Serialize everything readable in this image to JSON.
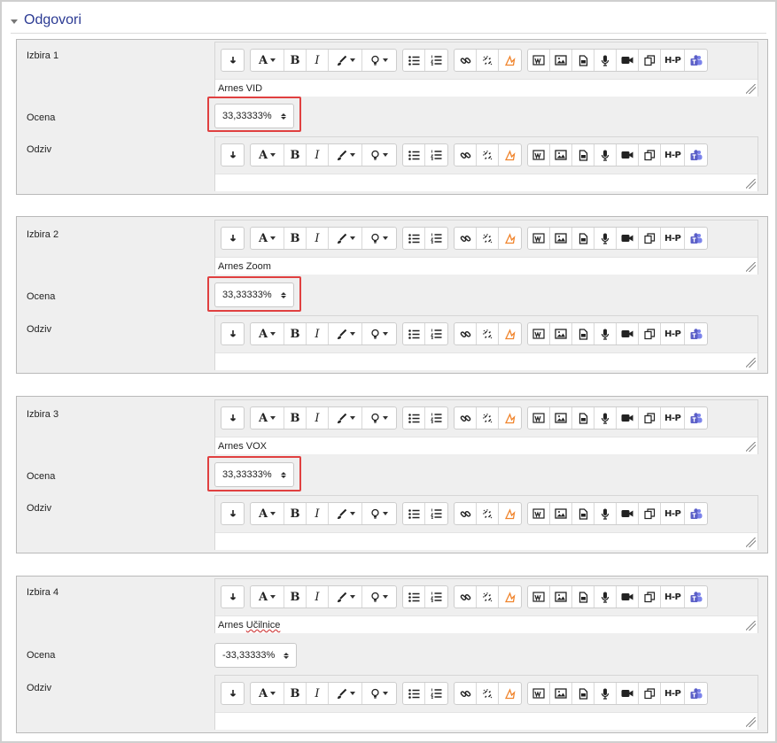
{
  "section": {
    "title": "Odgovori"
  },
  "labels": {
    "grade": "Ocena",
    "feedback": "Odziv"
  },
  "toolbar": [
    {
      "icon": "pilcrow-toggle-icon"
    },
    {
      "icon": "font-color-icon"
    },
    {
      "icon": "bold-icon",
      "text": "B"
    },
    {
      "icon": "italic-icon",
      "text": "I"
    },
    {
      "icon": "brush-icon"
    },
    {
      "icon": "lightbulb-icon"
    },
    {
      "icon": "unordered-list-icon"
    },
    {
      "icon": "ordered-list-icon"
    },
    {
      "icon": "link-icon"
    },
    {
      "icon": "unlink-icon"
    },
    {
      "icon": "emoji-icon"
    },
    {
      "icon": "media-manage-icon"
    },
    {
      "icon": "image-icon"
    },
    {
      "icon": "file-icon"
    },
    {
      "icon": "microphone-icon"
    },
    {
      "icon": "video-icon"
    },
    {
      "icon": "copy-icon"
    },
    {
      "icon": "h5p-icon",
      "text": "H‑P"
    },
    {
      "icon": "teams-icon"
    }
  ],
  "choices": [
    {
      "label": "Izbira 1",
      "text": "Arnes VID",
      "grade": "33,33333%",
      "feedback": ""
    },
    {
      "label": "Izbira 2",
      "text": "Arnes Zoom",
      "grade": "33,33333%",
      "feedback": ""
    },
    {
      "label": "Izbira 3",
      "text": "Arnes VOX",
      "grade": "33,33333%",
      "feedback": ""
    },
    {
      "label": "Izbira 4",
      "text_prefix": "Arnes ",
      "text_marked": "Učilnice",
      "grade": "-33,33333%",
      "feedback": ""
    }
  ],
  "colors": {
    "highlight": "#e04040",
    "section_title": "#2b3a93",
    "emoji_orange": "#f0842c",
    "teams_purple": "#5b5fc7"
  }
}
